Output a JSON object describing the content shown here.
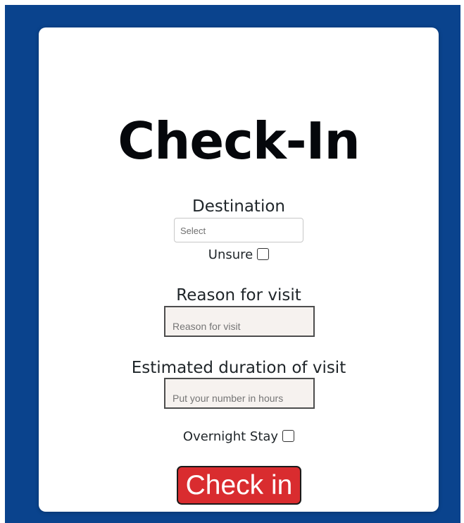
{
  "page": {
    "title": "Check-In"
  },
  "destination": {
    "label": "Destination",
    "select_value": "Select",
    "unsure_label": "Unsure"
  },
  "reason": {
    "label": "Reason for visit",
    "placeholder": "Reason for visit"
  },
  "duration": {
    "label": "Estimated duration of visit",
    "placeholder": "Put your number in hours"
  },
  "overnight": {
    "label": "Overnight Stay"
  },
  "submit": {
    "label": "Check in"
  },
  "colors": {
    "background": "#0a438d",
    "card": "#ffffff",
    "button": "#d92c2f",
    "input_bg": "#f6f2ef"
  }
}
